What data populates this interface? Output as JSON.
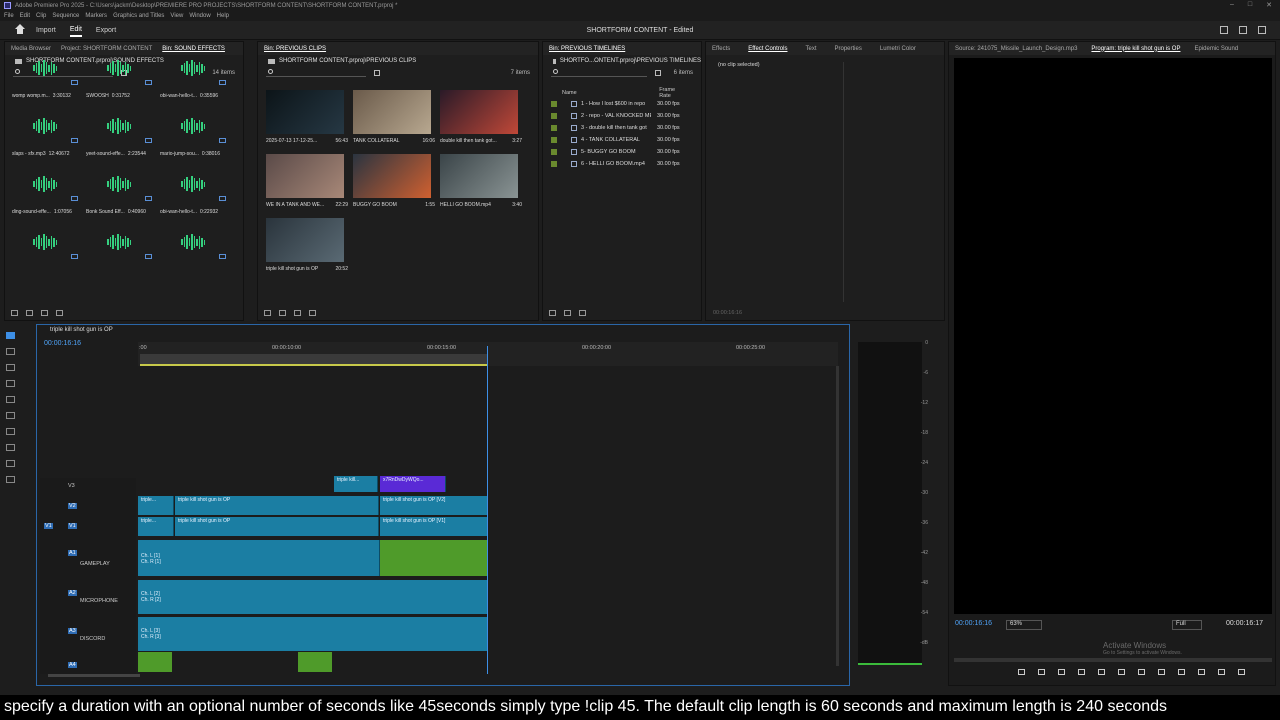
{
  "app": {
    "title_bar": "Adobe Premiere Pro 2025 - C:\\Users\\jackm\\Desktop\\PREMIERE PRO PROJECTS\\SHORTFORM CONTENT\\SHORTFORM CONTENT.prproj *",
    "menu": [
      "File",
      "Edit",
      "Clip",
      "Sequence",
      "Markers",
      "Graphics and Titles",
      "View",
      "Window",
      "Help"
    ]
  },
  "workspace": {
    "tabs": [
      "Import",
      "Edit",
      "Export"
    ],
    "active_tab": "Edit",
    "doc_title": "SHORTFORM CONTENT - Edited"
  },
  "sfx_panel": {
    "tabs": [
      "Media Browser",
      "Project: SHORTFORM CONTENT",
      "Bin: SOUND EFFECTS"
    ],
    "path": "SHORTFORM CONTENT.prproj\\SOUND EFFECTS",
    "count": "14 items",
    "items": [
      {
        "name": "womp womp.m...",
        "dur": "3:30132"
      },
      {
        "name": "SWOOSH",
        "dur": "0:31752"
      },
      {
        "name": "obi-wan-hello-t...",
        "dur": "0:35596"
      },
      {
        "name": "slaps - sfx.mp3",
        "dur": "12:40672"
      },
      {
        "name": "yeet-sound-effe...",
        "dur": "2:23544"
      },
      {
        "name": "mario-jump-sou...",
        "dur": "0:38016"
      },
      {
        "name": "ding-sound-effe...",
        "dur": "1:07056"
      },
      {
        "name": "Bonk Sound Eff...",
        "dur": "0:40960"
      },
      {
        "name": "obi-wan-hello-t...",
        "dur": "0:22932"
      },
      {
        "name": "",
        "dur": ""
      },
      {
        "name": "",
        "dur": ""
      },
      {
        "name": "",
        "dur": ""
      }
    ]
  },
  "clips_panel": {
    "tab": "Bin: PREVIOUS CLIPS",
    "path": "SHORTFORM CONTENT.prproj\\PREVIOUS CLIPS",
    "count": "7 items",
    "items": [
      {
        "name": "2025-07-13 17-12-25...",
        "dur": "56:43"
      },
      {
        "name": "TANK COLLATERAL",
        "dur": "16:06"
      },
      {
        "name": "double kill then tank got...",
        "dur": "3:27"
      },
      {
        "name": "WE IN A TANK AND WE...",
        "dur": "22:29"
      },
      {
        "name": "BUGGY GO BOOM",
        "dur": "1:55"
      },
      {
        "name": "HELLI GO BOOM.mp4",
        "dur": "3:40"
      },
      {
        "name": "triple kill shot gun is OP",
        "dur": "20:52"
      }
    ]
  },
  "timelines_panel": {
    "tab": "Bin: PREVIOUS TIMELINES",
    "path": "SHORTFO...ONTENT.prproj\\PREVIOUS TIMELINES",
    "count": "6 items",
    "col_name": "Name",
    "col_rate": "Frame Rate",
    "items": [
      {
        "name": "1 - How I lost $600 in repo",
        "rate": "30.00 fps"
      },
      {
        "name": "2 - repo - VAL KNOCKED ME",
        "rate": "30.00 fps"
      },
      {
        "name": "3 - double kill then tank got",
        "rate": "30.00 fps"
      },
      {
        "name": "4 - TANK COLLATERAL",
        "rate": "30.00 fps"
      },
      {
        "name": "5- BUGGY GO BOOM",
        "rate": "30.00 fps"
      },
      {
        "name": "6 - HELLI GO BOOM.mp4",
        "rate": "30.00 fps"
      }
    ]
  },
  "effects_panel": {
    "tabs": [
      "Effects",
      "Effect Controls",
      "Text",
      "Properties",
      "Lumetri Color"
    ],
    "no_clip": "(no clip selected)",
    "time": "00:00:16:16"
  },
  "program_panel": {
    "tabs": [
      "Source: 241075_Missile_Launch_Design.mp3",
      "Program: triple kill shot gun is OP",
      "Epidemic Sound"
    ],
    "time_left": "00:00:16:16",
    "zoom": "63%",
    "quality": "Full",
    "time_right": "00:00:16:17",
    "watermark_title": "Activate Windows",
    "watermark_sub": "Go to Settings to activate Windows."
  },
  "timeline": {
    "tab": "triple kill shot gun is OP",
    "time": "00:00:16:16",
    "ruler": [
      ":00",
      "00:00:10:00",
      "00:00:15:00",
      "00:00:20:00",
      "00:00:25:00"
    ],
    "tracks": {
      "v3": "V3",
      "v2": "V2",
      "v1": "V1",
      "a1": "A1",
      "a1_name": "GAMEPLAY",
      "a2": "A2",
      "a2_name": "MICROPHONE",
      "a3": "A3",
      "a3_name": "DISCORD",
      "a4": "A4"
    },
    "clips": {
      "v3a": "triple kill...",
      "v3b": "x7RnDwDyWQo...",
      "v2a": "triple...",
      "v2b": "triple kill shot gun is OP",
      "v2c": "triple kill shot gun is OP [V2]",
      "v1a": "triple...",
      "v1b": "triple kill shot gun is OP",
      "v1c": "triple kill shot gun is OP [V1]",
      "a1a": "Ch. L [1]",
      "a1b": "Ch. R [1]",
      "a2a": "Ch. L [2]",
      "a2b": "Ch. R [2]",
      "a3a": "Ch. L [3]",
      "a3b": "Ch. R [3]"
    }
  },
  "meter_scale": [
    "0",
    "-6",
    "-12",
    "-18",
    "-24",
    "-30",
    "-36",
    "-42",
    "-48",
    "-54",
    "-dB"
  ],
  "caption": "specify a duration with an optional number of seconds like 45seconds simply type !clip 45. The default clip length is 60 seconds and maximum length is 240 seconds",
  "colors": {
    "accent": "#3d8fe6",
    "clip_blue": "#1b7ea3",
    "audio_green": "#35d07f",
    "timecode": "#4fa3f7"
  }
}
